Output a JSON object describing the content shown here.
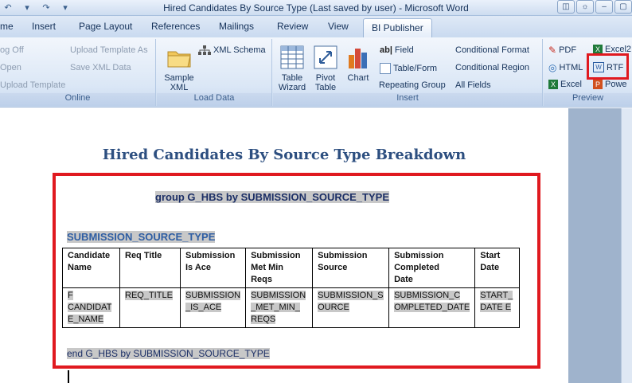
{
  "window": {
    "title": "Hired Candidates By Source Type (Last saved by user) - Microsoft Word"
  },
  "tabs": [
    {
      "label": "me"
    },
    {
      "label": "Insert"
    },
    {
      "label": "Page Layout"
    },
    {
      "label": "References"
    },
    {
      "label": "Mailings"
    },
    {
      "label": "Review"
    },
    {
      "label": "View"
    },
    {
      "label": "BI Publisher"
    }
  ],
  "ribbon": {
    "online": {
      "label": "Online",
      "log_off": "og Off",
      "open": "Open",
      "upload_template": "Upload Template",
      "upload_template_as": "Upload Template As",
      "save_xml": "Save XML Data"
    },
    "load_data": {
      "label": "Load Data",
      "sample_xml": "Sample\nXML",
      "xml_schema": "XML Schema"
    },
    "insert": {
      "label": "Insert",
      "table_wizard": "Table\nWizard",
      "pivot_table": "Pivot\nTable",
      "chart": "Chart",
      "field": "Field",
      "table_form": "Table/Form",
      "repeating_group": "Repeating Group",
      "conditional_format": "Conditional Format",
      "conditional_region": "Conditional Region",
      "all_fields": "All Fields"
    },
    "preview": {
      "label": "Preview",
      "pdf": "PDF",
      "html": "HTML",
      "excel": "Excel",
      "excel2": "Excel2",
      "rtf": "RTF",
      "power": "Powe"
    }
  },
  "document": {
    "title": "Hired Candidates By Source Type Breakdown",
    "group_field": "group G_HBS by SUBMISSION_SOURCE_TYPE",
    "source_type_field": "SUBMISSION_SOURCE_TYPE",
    "end_field": "end G_HBS by SUBMISSION_SOURCE_TYPE",
    "table": {
      "headers": [
        "Candidate\nName",
        "Req Title",
        "Submission\nIs Ace",
        "Submission\nMet Min\nReqs",
        "Submission\nSource",
        "Submission\nCompleted\nDate",
        "Start\nDate"
      ],
      "row": [
        "F\nCANDIDAT\nE_NAME",
        "REQ_TITLE",
        "SUBMISSION\n_IS_ACE",
        "SUBMISSION\n_MET_MIN_\nREQS",
        "SUBMISSION_S\nOURCE",
        "SUBMISSION_C\nOMPLETED_DATE",
        "START_\nDATE E"
      ]
    }
  },
  "colors": {
    "highlight_red": "#e0191f",
    "field_grey": "#c8c8c8",
    "title_blue": "#2d4f80"
  }
}
